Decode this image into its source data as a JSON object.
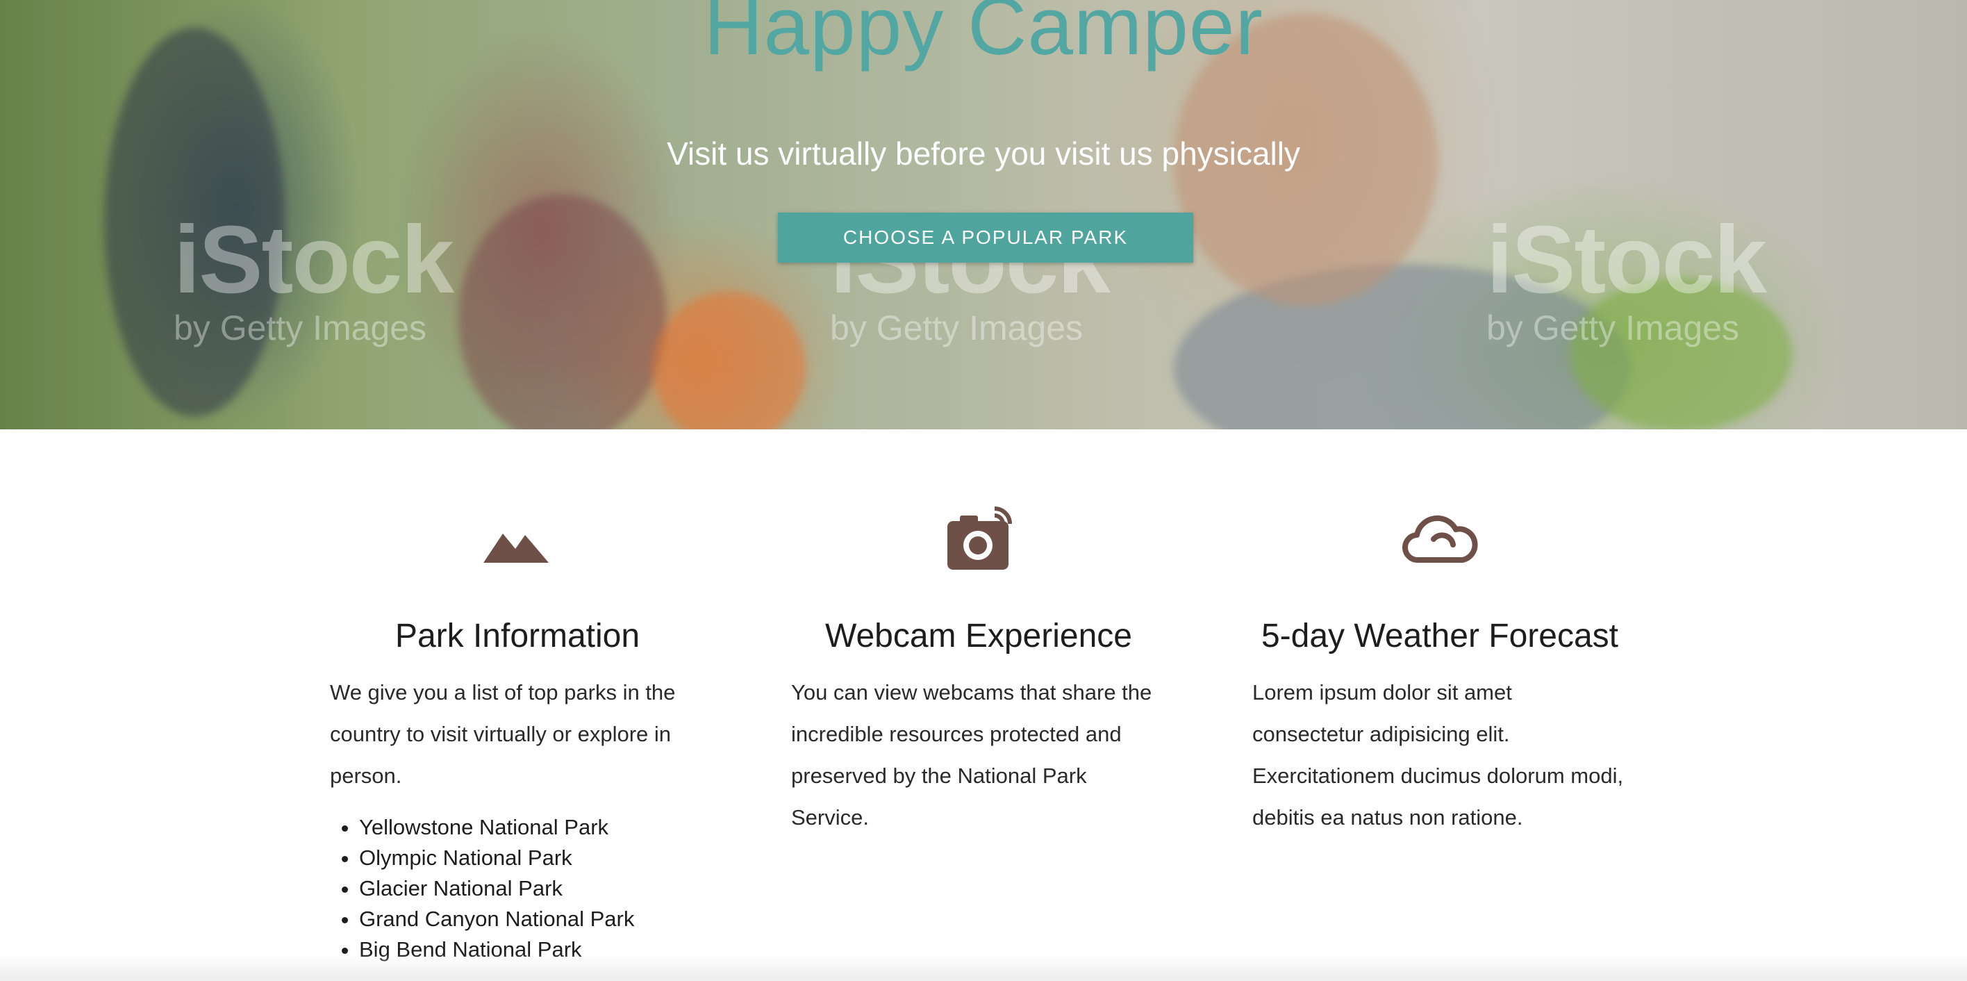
{
  "hero": {
    "title": "Happy Camper",
    "subtitle": "Visit us virtually before you visit us physically",
    "cta_label": "CHOOSE A POPULAR PARK",
    "watermark_main": "iStock",
    "watermark_sub": "by Getty Images"
  },
  "features": [
    {
      "icon": "mountain-icon",
      "title": "Park Information",
      "text": "We give you a list of top parks in the country to visit virtually or explore in person.",
      "parks": [
        "Yellowstone National Park",
        "Olympic National Park",
        "Glacier National Park",
        "Grand Canyon National Park",
        "Big Bend National Park"
      ]
    },
    {
      "icon": "camera-icon",
      "title": "Webcam Experience",
      "text": "You can view webcams that share the incredible resources protected and preserved by the National Park Service."
    },
    {
      "icon": "cloud-icon",
      "title": "5-day Weather Forecast",
      "text": "Lorem ipsum dolor sit amet consectetur adipisicing elit. Exercitationem ducimus dolorum modi, debitis ea natus non ratione."
    }
  ],
  "colors": {
    "accent": "#52a7a3",
    "button": "#4fa59e",
    "icon": "#6f5048"
  }
}
